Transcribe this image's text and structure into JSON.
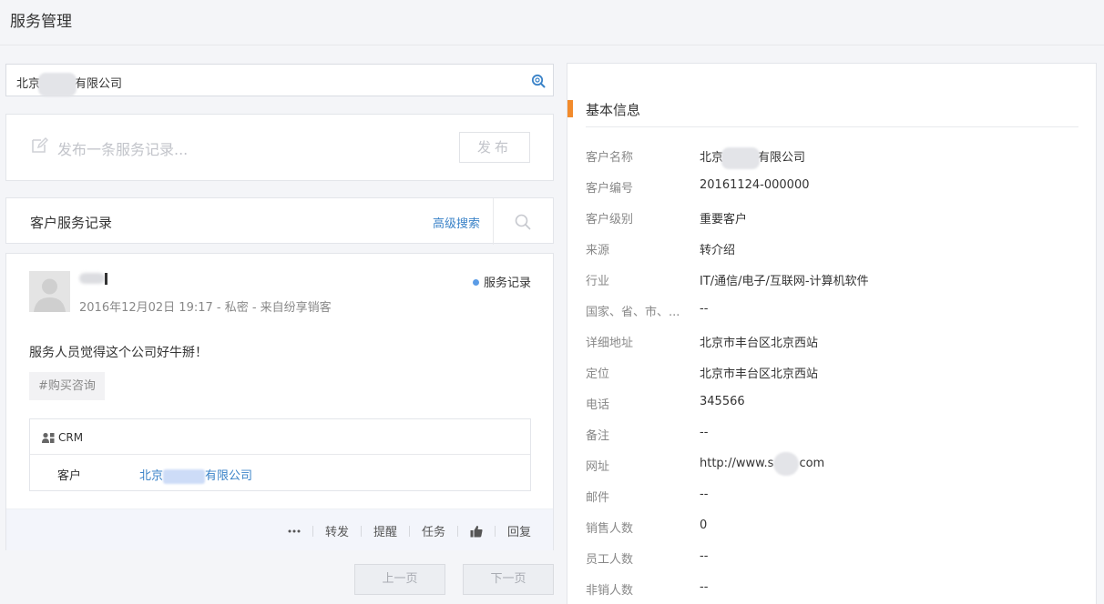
{
  "page": {
    "title": "服务管理"
  },
  "search": {
    "value_prefix": "北京",
    "value_suffix": "有限公司"
  },
  "publish": {
    "placeholder": "发布一条服务记录...",
    "button": "发布"
  },
  "records": {
    "title": "客户服务记录",
    "advanced_search": "高级搜索"
  },
  "record": {
    "meta": "2016年12月02日 19:17 - 私密 - 来自纷享销客",
    "type": "服务记录",
    "content": "服务人员觉得这个公司好牛掰！",
    "tag": "#购买咨询",
    "crm_label": "CRM",
    "crm_field_label": "客户",
    "crm_value_prefix": "北京",
    "crm_value_suffix": "有限公司",
    "actions": {
      "forward": "转发",
      "remind": "提醒",
      "task": "任务",
      "reply": "回复"
    }
  },
  "pager": {
    "prev": "上一页",
    "next": "下一页"
  },
  "info": {
    "title": "基本信息",
    "name_prefix": "北京",
    "name_suffix": "有限公司",
    "url_prefix": "http://www.s",
    "url_suffix": "com",
    "rows": [
      {
        "label": "客户名称",
        "value": ""
      },
      {
        "label": "客户编号",
        "value": "20161124-000000"
      },
      {
        "label": "客户级别",
        "value": "重要客户"
      },
      {
        "label": "来源",
        "value": "转介绍"
      },
      {
        "label": "行业",
        "value": "IT/通信/电子/互联网-计算机软件"
      },
      {
        "label": "国家、省、市、...",
        "value": "--"
      },
      {
        "label": "详细地址",
        "value": "北京市丰台区北京西站"
      },
      {
        "label": "定位",
        "value": "北京市丰台区北京西站"
      },
      {
        "label": "电话",
        "value": "345566"
      },
      {
        "label": "备注",
        "value": "--"
      },
      {
        "label": "网址",
        "value": ""
      },
      {
        "label": "邮件",
        "value": "--"
      },
      {
        "label": "销售人数",
        "value": "0"
      },
      {
        "label": "员工人数",
        "value": "--"
      },
      {
        "label": "非销人数",
        "value": "--"
      }
    ]
  },
  "colors": {
    "accent": "#3b83c8",
    "title_bar": "#f28b2c",
    "type_dot": "#5b9ce6"
  }
}
